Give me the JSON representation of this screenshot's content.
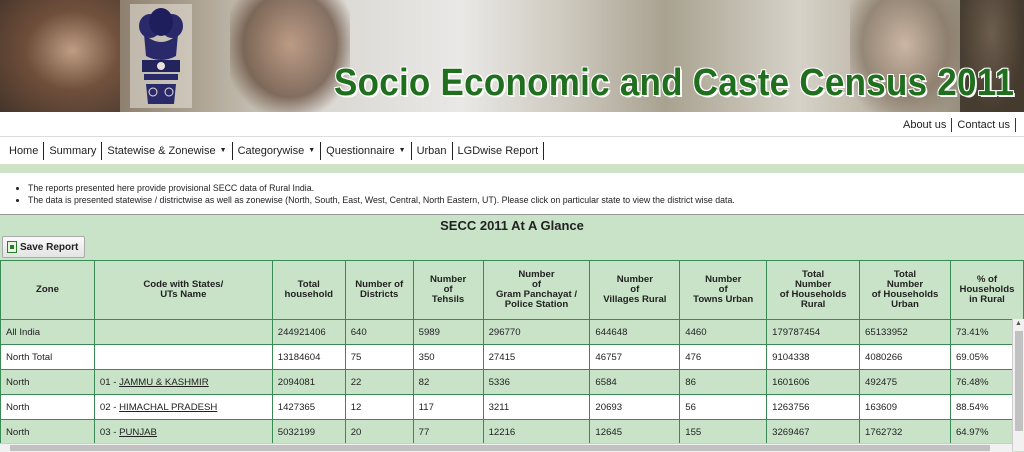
{
  "banner": {
    "title": "Socio Economic and Caste Census 2011"
  },
  "toplinks": [
    "About us",
    "Contact us"
  ],
  "nav": [
    {
      "label": "Home",
      "dropdown": false
    },
    {
      "label": "Summary",
      "dropdown": false
    },
    {
      "label": "Statewise & Zonewise",
      "dropdown": true
    },
    {
      "label": "Categorywise",
      "dropdown": true
    },
    {
      "label": "Questionnaire",
      "dropdown": true
    },
    {
      "label": "Urban",
      "dropdown": false
    },
    {
      "label": "LGDwise Report",
      "dropdown": false
    }
  ],
  "notes": [
    "The reports presented here provide provisional SECC data of Rural India.",
    "The data is presented statewise / districtwise as well as zonewise (North, South, East, West, Central, North Eastern, UT). Please click on particular state to view the district wise data."
  ],
  "panel": {
    "title": "SECC 2011 At A Glance",
    "save_label": "Save Report"
  },
  "table": {
    "headers": [
      [
        "Zone"
      ],
      [
        "Code with States/",
        "UTs Name"
      ],
      [
        "Total",
        "household"
      ],
      [
        "Number of",
        "Districts"
      ],
      [
        "Number",
        "of",
        "Tehsils"
      ],
      [
        "Number",
        "of",
        "Gram Panchayat /",
        "Police Station"
      ],
      [
        "Number",
        "of",
        "Villages Rural"
      ],
      [
        "Number",
        "of",
        "Towns Urban"
      ],
      [
        "Total",
        "Number",
        "of Households",
        "Rural"
      ],
      [
        "Total",
        "Number",
        "of Households",
        "Urban"
      ],
      [
        "% of",
        "Households",
        "in Rural"
      ]
    ],
    "rows": [
      {
        "zone": "All India",
        "code": "",
        "state": "",
        "cells": [
          "244921406",
          "640",
          "5989",
          "296770",
          "644648",
          "4460",
          "179787454",
          "65133952",
          "73.41%"
        ]
      },
      {
        "zone": "North Total",
        "code": "",
        "state": "",
        "cells": [
          "13184604",
          "75",
          "350",
          "27415",
          "46757",
          "476",
          "9104338",
          "4080266",
          "69.05%"
        ]
      },
      {
        "zone": "North",
        "code": "01 - ",
        "state": "JAMMU & KASHMIR",
        "cells": [
          "2094081",
          "22",
          "82",
          "5336",
          "6584",
          "86",
          "1601606",
          "492475",
          "76.48%"
        ]
      },
      {
        "zone": "North",
        "code": "02 - ",
        "state": "HIMACHAL PRADESH",
        "cells": [
          "1427365",
          "12",
          "117",
          "3211",
          "20693",
          "56",
          "1263756",
          "163609",
          "88.54%"
        ]
      },
      {
        "zone": "North",
        "code": "03 - ",
        "state": "PUNJAB",
        "cells": [
          "5032199",
          "20",
          "77",
          "12216",
          "12645",
          "155",
          "3269467",
          "1762732",
          "64.97%"
        ]
      }
    ]
  },
  "colors": {
    "title_green": "#1f6f1e",
    "grid_green": "#c9e3c8",
    "grid_border": "#3a8a55"
  }
}
